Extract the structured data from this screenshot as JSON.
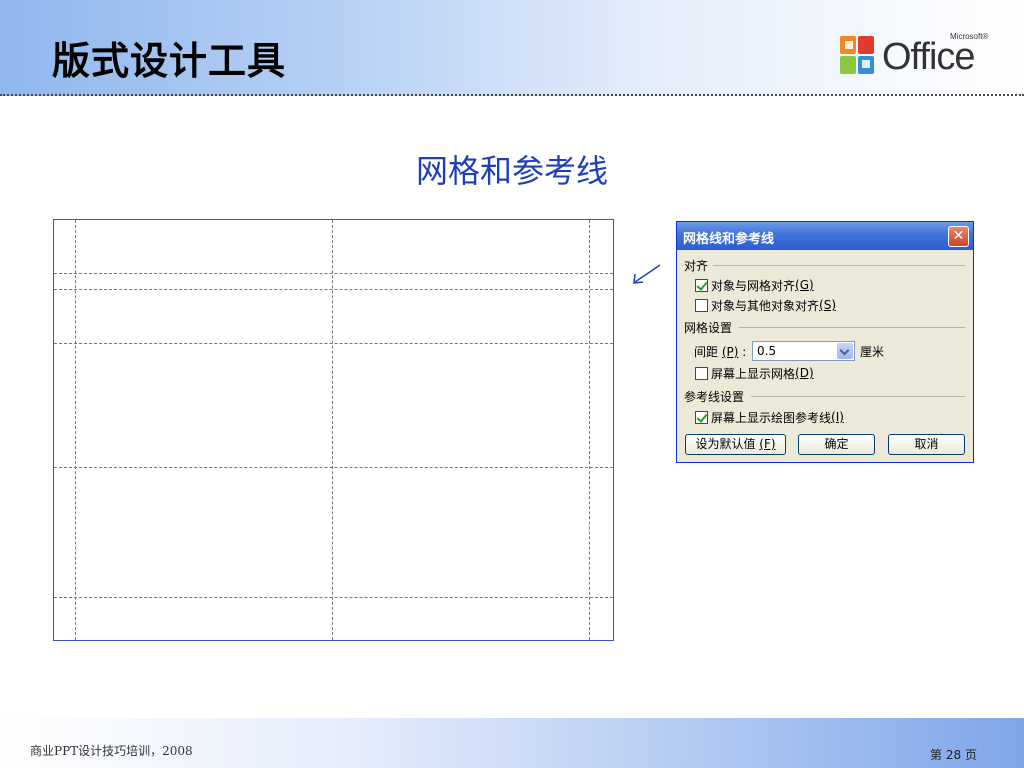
{
  "slide": {
    "title": "版式设计工具",
    "subtitle": "网格和参考线",
    "logo": {
      "brand": "Microsoft®",
      "word": "Office"
    }
  },
  "dialog": {
    "title": "网格线和参考线",
    "close_label": "✕",
    "align_section": "对齐",
    "snap_grid_label": "对象与网格对齐",
    "snap_grid_key": "(G)",
    "snap_grid_checked": true,
    "snap_objects_label": "对象与其他对象对齐",
    "snap_objects_key": "(S)",
    "snap_objects_checked": false,
    "grid_section": "网格设置",
    "spacing_label": "间距",
    "spacing_key": "(P)",
    "spacing_colon": ":",
    "spacing_value": "0.5",
    "spacing_unit": "厘米",
    "show_grid_label": "屏幕上显示网格",
    "show_grid_key": "(D)",
    "show_grid_checked": false,
    "guides_section": "参考线设置",
    "show_guides_label": "屏幕上显示绘图参考线",
    "show_guides_key": "(I)",
    "show_guides_checked": true,
    "default_button": "设为默认值",
    "default_key": "(F)",
    "ok_button": "确定",
    "cancel_button": "取消"
  },
  "footer": {
    "left": "商业PPT设计技巧培训，2008",
    "page_prefix": "第",
    "page_number": "28",
    "page_suffix": "页"
  },
  "colors": {
    "title_blue": "#1f3fb8",
    "dialog_titlebar": "#2c5ecf",
    "dialog_body": "#ece9d8",
    "grid_border": "#3b4fc7"
  }
}
